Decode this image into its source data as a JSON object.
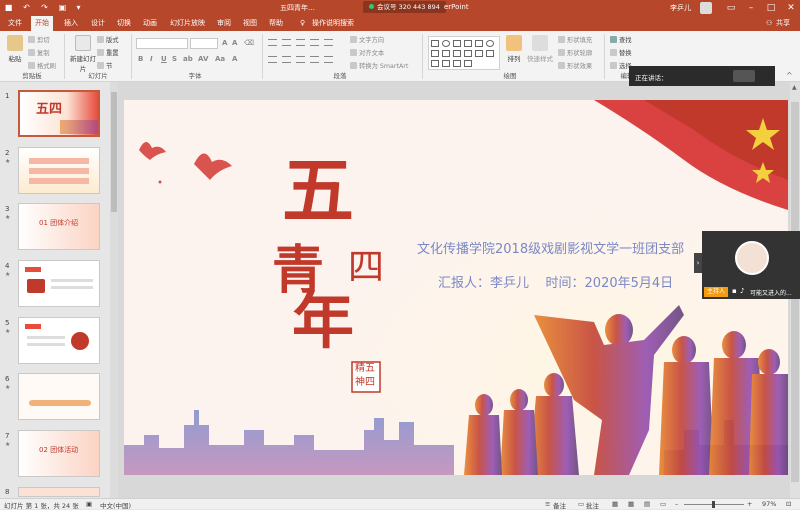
{
  "window": {
    "title": "五四青年…",
    "app_suffix": "erPoint",
    "meeting_label": "会议号 320 443 894",
    "user_name": "李乒儿",
    "share_label": "共享"
  },
  "tabs": [
    "文件",
    "开始",
    "插入",
    "设计",
    "切换",
    "动画",
    "幻灯片放映",
    "审阅",
    "视图",
    "帮助"
  ],
  "tell_me": "操作说明搜索",
  "ribbon": {
    "clipboard": {
      "paste": "粘贴",
      "cut": "剪切",
      "copy": "复制",
      "format_painter": "格式刷",
      "label": "剪贴板"
    },
    "slides": {
      "new_slide": "新建幻灯片",
      "layout": "版式",
      "reset": "重置",
      "section": "节",
      "label": "幻灯片"
    },
    "font": {
      "label": "字体"
    },
    "paragraph": {
      "text_direction": "文字方向",
      "align_text": "对齐文本",
      "smartart": "转换为 SmartArt",
      "label": "段落"
    },
    "drawing": {
      "arrange": "排列",
      "quick_styles": "快速样式",
      "shape_fill": "形状填充",
      "shape_outline": "形状轮廓",
      "shape_effects": "形状效果",
      "label": "绘图"
    },
    "editing": {
      "find": "查找",
      "replace": "替换",
      "select": "选择",
      "label": "编辑"
    }
  },
  "thumbnails": [
    {
      "num": "1",
      "star": "",
      "caption": "五四",
      "accent": "#c0392b"
    },
    {
      "num": "2",
      "star": "★",
      "caption": "",
      "accent": "#d35400"
    },
    {
      "num": "3",
      "star": "★",
      "caption": "01 团体介绍",
      "accent": "#c0392b"
    },
    {
      "num": "4",
      "star": "★",
      "caption": "",
      "accent": "#c0392b"
    },
    {
      "num": "5",
      "star": "★",
      "caption": "",
      "accent": "#c0392b"
    },
    {
      "num": "6",
      "star": "★",
      "caption": "",
      "accent": "#e67e22"
    },
    {
      "num": "7",
      "star": "★",
      "caption": "02 团体活动",
      "accent": "#c0392b"
    },
    {
      "num": "8",
      "star": "",
      "caption": "",
      "accent": "#c0392b"
    }
  ],
  "slide": {
    "calligraphy": [
      "五",
      "四",
      "青",
      "年"
    ],
    "seal_top": "精五",
    "seal_bottom": "神四",
    "org_line": "文化传播学院2018级戏剧影视文学一班团支部",
    "reporter_line": "汇报人：李乒儿    时间：2020年5月4日"
  },
  "overlays": {
    "speaking_label": "正在讲话：",
    "host_badge": "主持人",
    "host_name": "可能又进入的..."
  },
  "status": {
    "slide_pos": "幻灯片 第 1 张，共 24 张",
    "language": "中文(中国)",
    "notes": "备注",
    "comments": "批注",
    "zoom": "97%"
  },
  "colors": {
    "accent": "#b7472a",
    "slide_red": "#c0392b",
    "title_blue": "#7a89c4"
  }
}
